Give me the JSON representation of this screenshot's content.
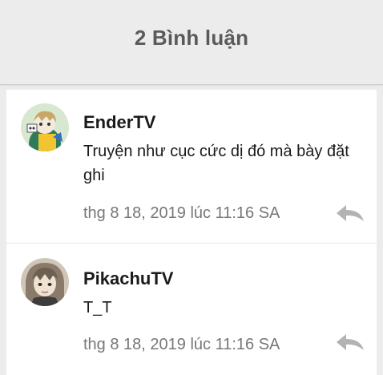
{
  "header": {
    "title": "2 Bình luận"
  },
  "comments": [
    {
      "author": "EnderTV",
      "text": "Truyện như cục cức dị đó mà bày đặt ghi",
      "timestamp": "thg 8 18, 2019 lúc 11:16 SA",
      "avatar_icon": "avatar-anime-character",
      "reply_icon": "reply-arrow-icon"
    },
    {
      "author": "PikachuTV",
      "text": "T_T",
      "timestamp": "thg 8 18, 2019 lúc 11:16 SA",
      "avatar_icon": "avatar-anime-character",
      "reply_icon": "reply-arrow-icon"
    }
  ],
  "colors": {
    "background": "#ececec",
    "card": "#ffffff",
    "title": "#5a5a5a",
    "author": "#1a1a1a",
    "timestamp": "#777777",
    "reply_icon": "#b3b3b3"
  }
}
